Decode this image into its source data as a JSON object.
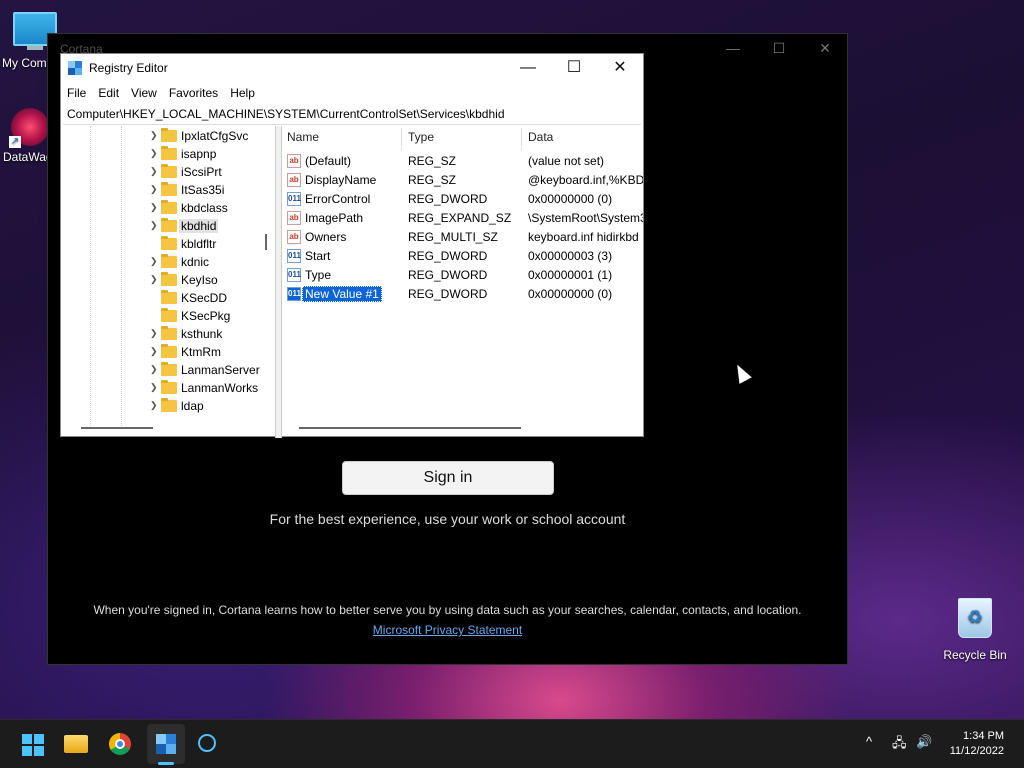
{
  "desktop": {
    "icons": [
      {
        "label": "My Com"
      },
      {
        "label": "DataWag"
      },
      {
        "label": "Recycle Bin"
      }
    ]
  },
  "cortana": {
    "title": "Cortana",
    "signin_label": "Sign in",
    "subtitle": "For the best experience, use your work or school account",
    "note": "When you're signed in, Cortana learns how to better serve you by using data such as your searches, calendar, contacts, and location.",
    "privacy_link": "Microsoft Privacy Statement",
    "controls": {
      "minimize": "—",
      "maximize": "☐",
      "close": "✕"
    }
  },
  "regedit": {
    "title": "Registry Editor",
    "controls": {
      "minimize": "—",
      "maximize": "☐",
      "close": "✕"
    },
    "menu": [
      "File",
      "Edit",
      "View",
      "Favorites",
      "Help"
    ],
    "address": "Computer\\HKEY_LOCAL_MACHINE\\SYSTEM\\CurrentControlSet\\Services\\kbdhid",
    "tree": [
      {
        "label": "IpxlatCfgSvc",
        "expandable": true
      },
      {
        "label": "isapnp",
        "expandable": true
      },
      {
        "label": "iScsiPrt",
        "expandable": true
      },
      {
        "label": "ItSas35i",
        "expandable": true
      },
      {
        "label": "kbdclass",
        "expandable": true
      },
      {
        "label": "kbdhid",
        "expandable": true,
        "selected": true
      },
      {
        "label": "kbldfltr",
        "expandable": false
      },
      {
        "label": "kdnic",
        "expandable": true
      },
      {
        "label": "KeyIso",
        "expandable": true
      },
      {
        "label": "KSecDD",
        "expandable": false
      },
      {
        "label": "KSecPkg",
        "expandable": false
      },
      {
        "label": "ksthunk",
        "expandable": true
      },
      {
        "label": "KtmRm",
        "expandable": true
      },
      {
        "label": "LanmanServer",
        "expandable": true
      },
      {
        "label": "LanmanWorks",
        "expandable": true
      },
      {
        "label": "ldap",
        "expandable": true
      }
    ],
    "columns": [
      "Name",
      "Type",
      "Data"
    ],
    "values": [
      {
        "name": "(Default)",
        "type": "REG_SZ",
        "data": "(value not set)",
        "icon": "ab"
      },
      {
        "name": "DisplayName",
        "type": "REG_SZ",
        "data": "@keyboard.inf,%KBDI",
        "icon": "ab"
      },
      {
        "name": "ErrorControl",
        "type": "REG_DWORD",
        "data": "0x00000000 (0)",
        "icon": "011"
      },
      {
        "name": "ImagePath",
        "type": "REG_EXPAND_SZ",
        "data": "\\SystemRoot\\System3",
        "icon": "ab"
      },
      {
        "name": "Owners",
        "type": "REG_MULTI_SZ",
        "data": "keyboard.inf hidirkbd",
        "icon": "ab"
      },
      {
        "name": "Start",
        "type": "REG_DWORD",
        "data": "0x00000003 (3)",
        "icon": "011"
      },
      {
        "name": "Type",
        "type": "REG_DWORD",
        "data": "0x00000001 (1)",
        "icon": "011"
      },
      {
        "name": "New Value #1",
        "type": "REG_DWORD",
        "data": "0x00000000 (0)",
        "icon": "011",
        "selected": true
      }
    ]
  },
  "taskbar": {
    "tray": {
      "chevron": "^",
      "network": "🖧",
      "volume": "🔊"
    },
    "clock": {
      "time": "1:34 PM",
      "date": "11/12/2022"
    }
  },
  "colors": {
    "accent": "#4cc2ff",
    "selection": "#0a64d8",
    "link": "#6aa6f0"
  }
}
